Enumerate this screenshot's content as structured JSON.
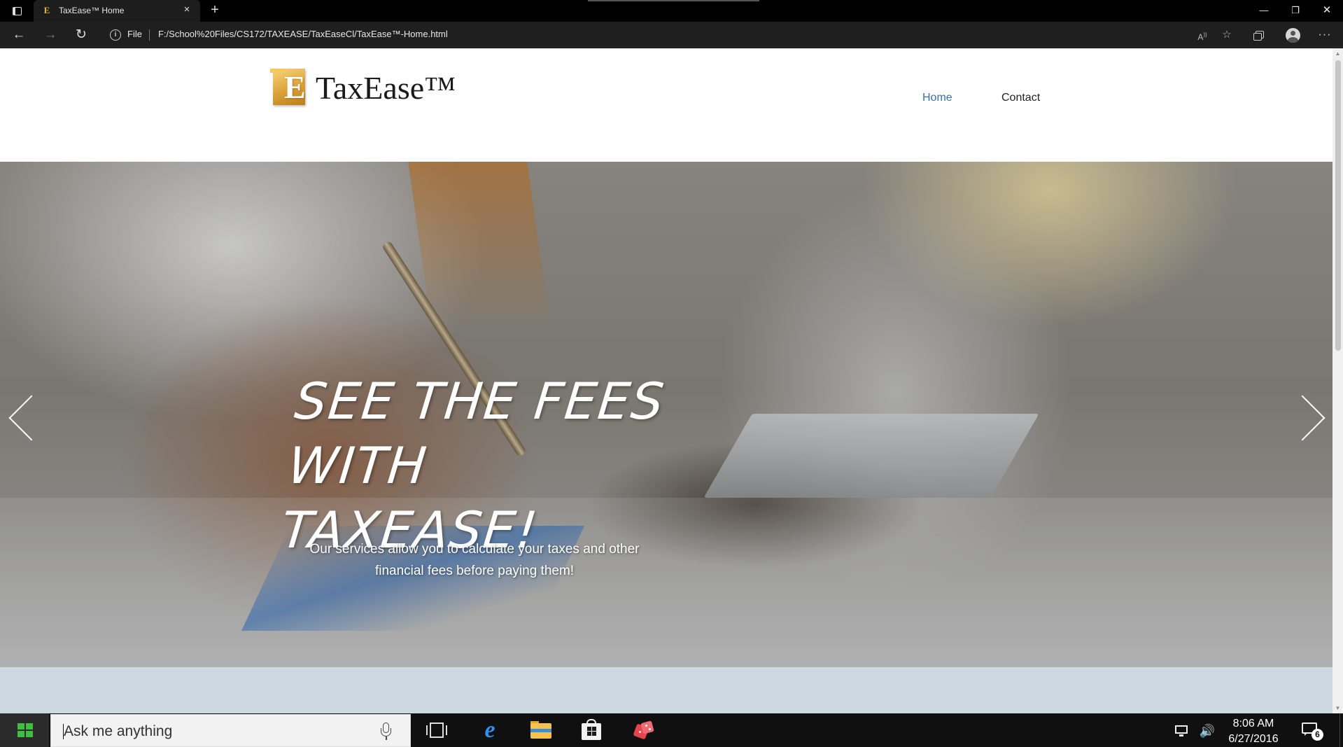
{
  "browser": {
    "tab_title": "TaxEase™ Home",
    "tab_favicon_letter": "E",
    "close_glyph": "×",
    "new_tab_glyph": "+",
    "address": {
      "security_label": "File",
      "url": "F:/School%20Files/CS172/TAXEASE/TaxEaseCl/TaxEase™-Home.html"
    },
    "icons": {
      "back": "arrow-left-icon",
      "forward": "arrow-right-icon",
      "reload": "reload-icon",
      "read_aloud": "read-aloud-icon",
      "favorites": "favorites-icon",
      "collections": "collections-icon",
      "profile": "profile-icon",
      "more": "more-icon"
    }
  },
  "site": {
    "logo_letter": "E",
    "logo_text": "TaxEase™",
    "nav": {
      "home": "Home",
      "contact": "Contact"
    },
    "nav_active_color": "#3b6ea8",
    "hero": {
      "title_line1": "SEE THE FEES",
      "title_line2": "WITH TAXEASE!",
      "text_line1": "Our services allow you to calculate your taxes and other",
      "text_line2": "financial fees before paying them!",
      "slide_count": 2
    },
    "section_strip_color": "#cdd9e1"
  },
  "taskbar": {
    "search_placeholder": "Ask me anything",
    "time": "8:06 AM",
    "date": "6/27/2016",
    "notification_count": "6",
    "apps": [
      "edge-icon",
      "file-explorer-icon",
      "store-icon",
      "game-icon"
    ]
  }
}
